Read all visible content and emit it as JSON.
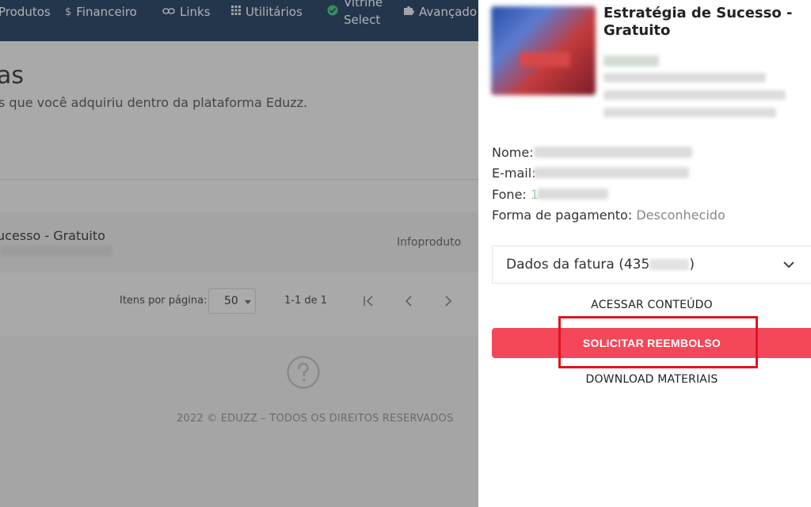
{
  "nav": {
    "items": [
      {
        "label": "Produtos",
        "icon": "box-icon"
      },
      {
        "label": "Financeiro",
        "icon": "dollar-icon"
      },
      {
        "label": "Links",
        "icon": "link-icon"
      },
      {
        "label": "Utilitários",
        "icon": "grid-icon"
      },
      {
        "label": "Vitrine Select",
        "icon": "check-badge-icon"
      },
      {
        "label": "Avançado",
        "icon": "puzzle-icon"
      }
    ],
    "vitrine_line1": "Vitrine",
    "vitrine_line2": "Select",
    "colors": {
      "bar": "#0d2b52",
      "accent": "#2fbf71"
    }
  },
  "page": {
    "heading": "as",
    "subtitle": "s que você adquiriu dentro da plataforma Eduzz."
  },
  "list": {
    "row_title": "ucesso - Gratuito",
    "row_type": "Infoproduto"
  },
  "pagination": {
    "items_label": "Itens por página:",
    "page_size": "50",
    "range": "1-1 de 1"
  },
  "footer": {
    "text": "2022 © EDUZZ – TODOS OS DIREITOS RESERVADOS"
  },
  "drawer": {
    "product_title": "Estratégia de Sucesso - Gratuito",
    "fields": {
      "name_label": "Nome:",
      "email_label": "E-mail:",
      "phone_label": "Fone:",
      "phone_prefix": "1",
      "payment_label": "Forma de pagamento:",
      "payment_value": "Desconhecido"
    },
    "invoice": {
      "label_prefix": "Dados da fatura (435",
      "label_suffix": ")"
    },
    "actions": {
      "access": "ACESSAR CONTEÚDO",
      "refund": "SOLICITAR REEMBOLSO",
      "download": "DOWNLOAD MATERIAIS"
    },
    "colors": {
      "refund_button": "#f4475a",
      "highlight_box": "#e0141e"
    }
  }
}
